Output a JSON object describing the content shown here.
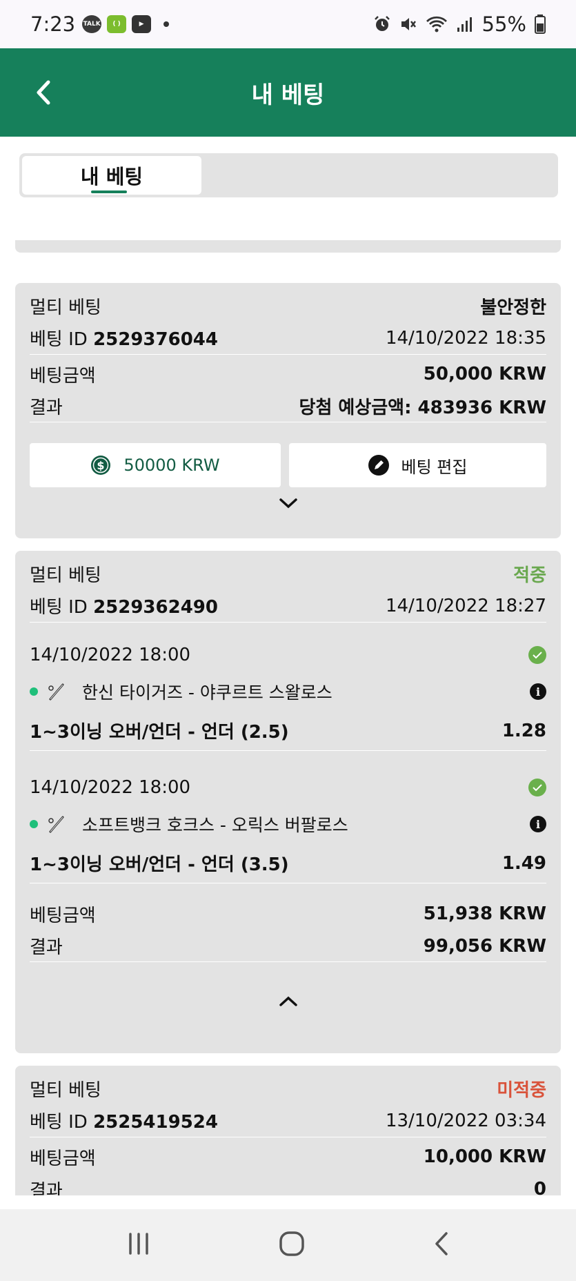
{
  "status": {
    "time": "7:23",
    "battery": "55%"
  },
  "appbar": {
    "title": "내 베팅"
  },
  "tabs": [
    {
      "label": "내 베팅"
    }
  ],
  "bets": [
    {
      "type": "멀티 베팅",
      "status": "불안정한",
      "id_label": "베팅 ID",
      "id": "2529376044",
      "date": "14/10/2022 18:35",
      "amount_label": "베팅금액",
      "amount": "50,000 KRW",
      "result_label": "결과",
      "result": "당첨 예상금액: 483936 KRW",
      "cashout_label": "50000  KRW",
      "edit_label": "베팅 편집"
    },
    {
      "type": "멀티 베팅",
      "status": "적중",
      "id_label": "베팅 ID",
      "id": "2529362490",
      "date": "14/10/2022 18:27",
      "selections": [
        {
          "date": "14/10/2022 18:00",
          "match": "한신 타이거즈 - 야쿠르트 스왈로스",
          "market": "1~3이닝 오버/언더 - 언더 (2.5)",
          "odds": "1.28"
        },
        {
          "date": "14/10/2022 18:00",
          "match": "소프트뱅크 호크스 - 오릭스 버팔로스",
          "market": "1~3이닝 오버/언더 - 언더 (3.5)",
          "odds": "1.49"
        }
      ],
      "amount_label": "베팅금액",
      "amount": "51,938 KRW",
      "result_label": "결과",
      "result": "99,056 KRW"
    },
    {
      "type": "멀티 베팅",
      "status": "미적중",
      "id_label": "베팅 ID",
      "id": "2525419524",
      "date": "13/10/2022 03:34",
      "amount_label": "베팅금액",
      "amount": "10,000 KRW",
      "result_label": "결과",
      "result": "0"
    }
  ],
  "colors": {
    "primary": "#16805b",
    "won": "#6aa84f",
    "lost": "#d9533b",
    "card": "#e3e3e3"
  }
}
